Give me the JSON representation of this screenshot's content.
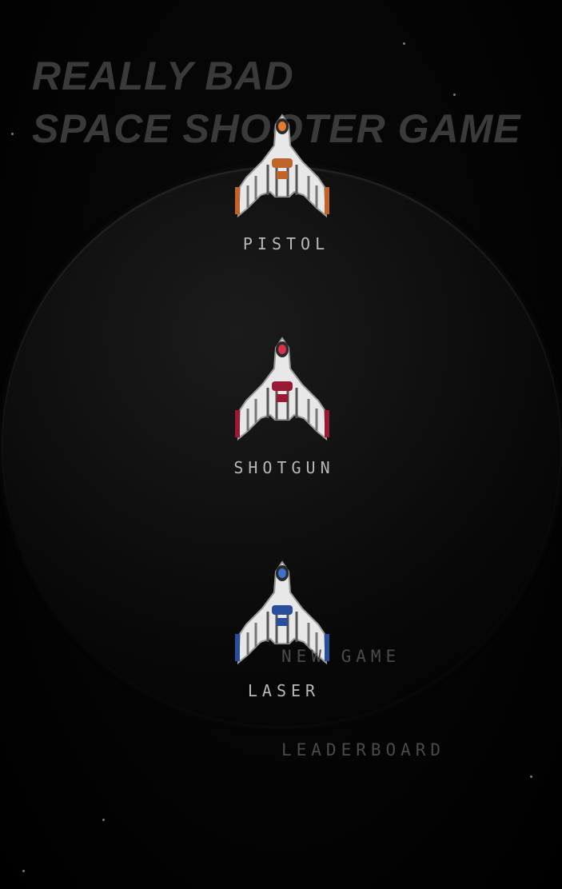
{
  "title": {
    "line1": "Really Bad",
    "line2": "Space Shooter Game"
  },
  "ships": [
    {
      "label": "PISTOL",
      "accent": "#c0652a",
      "core": "#e87a30"
    },
    {
      "label": "SHOTGUN",
      "accent": "#9a1a35",
      "core": "#d8324a"
    },
    {
      "label": "LASER",
      "accent": "#2a4f9a",
      "core": "#3a72d0"
    }
  ],
  "menu": {
    "new_game": "NEW GAME",
    "leaderboard": "LEADERBOARD"
  },
  "colors": {
    "background": "#000000",
    "title": "#3a3a3a",
    "ship_label": "#b8b8b8",
    "menu_text": "#4a4a4a"
  }
}
